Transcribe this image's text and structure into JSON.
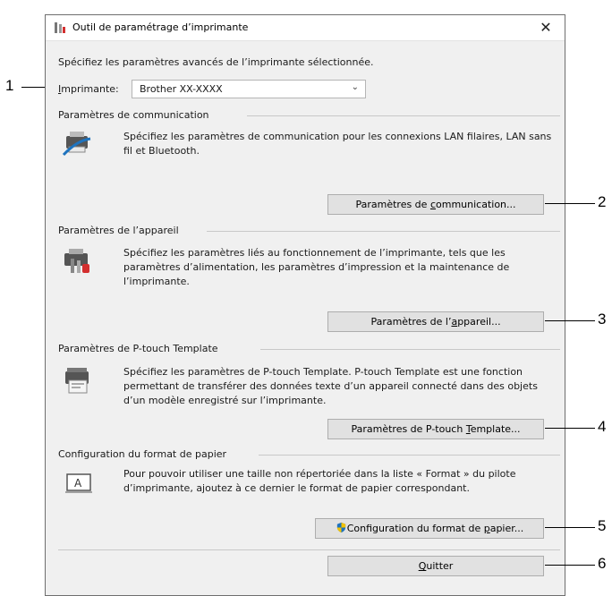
{
  "window": {
    "title": "Outil de paramétrage d’imprimante",
    "close_label": "✕"
  },
  "intro": "Spécifiez les paramètres avancés de l’imprimante sélectionnée.",
  "printer": {
    "label_underlined_char": "I",
    "label_rest": "mprimante:",
    "value": "Brother  XX-XXXX"
  },
  "sections": {
    "communication": {
      "title": "Paramètres de communication",
      "description": "Spécifiez les paramètres de communication pour les connexions LAN filaires, LAN sans fil et Bluetooth.",
      "button": {
        "before": "Paramètres de ",
        "accel": "c",
        "after": "ommunication..."
      },
      "icon": "printer-network-icon"
    },
    "device": {
      "title": "Paramètres de l’appareil",
      "description": "Spécifiez les paramètres liés au fonctionnement de l’imprimante, tels que les paramètres d’alimentation, les paramètres d’impression et la maintenance de l’imprimante.",
      "button": {
        "before": "Paramètres de l’",
        "accel": "a",
        "after": "ppareil..."
      },
      "icon": "printer-tools-icon"
    },
    "ptouch": {
      "title": "Paramètres de P-touch Template",
      "description": "Spécifiez les paramètres de P-touch Template. P-touch Template est une fonction permettant de transférer des données texte d’un appareil connecté dans des objets d’un modèle enregistré sur l’imprimante.",
      "button": {
        "before": "Paramètres de P-touch ",
        "accel": "T",
        "after": "emplate..."
      },
      "icon": "printer-template-icon"
    },
    "paper": {
      "title": "Configuration du format de papier",
      "description": "Pour pouvoir utiliser une taille non répertoriée dans la liste « Format » du pilote d’imprimante, ajoutez à ce dernier le format de papier correspondant.",
      "button": {
        "before": "Configuration du format de ",
        "accel": "p",
        "after": "apier..."
      },
      "icon": "paper-format-icon",
      "shield_icon": "uac-shield-icon"
    }
  },
  "quit_button": {
    "accel": "Q",
    "after": "uitter"
  },
  "callouts": [
    "1",
    "2",
    "3",
    "4",
    "5",
    "6"
  ],
  "colors": {
    "dialog_bg": "#f0f0f0",
    "button_bg": "#e1e1e1",
    "accent_blue": "#1e73be",
    "accent_red": "#d32f2f"
  }
}
